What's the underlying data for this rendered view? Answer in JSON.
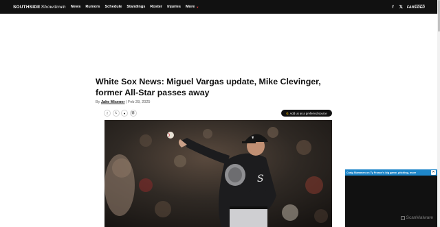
{
  "nav": {
    "logo_main": "SOUTHSIDE",
    "logo_script": "Showdown",
    "links": [
      "News",
      "Rumors",
      "Schedule",
      "Standings",
      "Roster",
      "Injuries"
    ],
    "more_label": "More",
    "social": {
      "facebook": "f",
      "x": "𝕏"
    },
    "fansided_small": "powered by",
    "fansided_big": "FANSIDED"
  },
  "article": {
    "headline": "White Sox News: Miguel Vargas update, Mike Clevinger, former All-Star passes away",
    "by_prefix": "By ",
    "author": "Jake Misener",
    "separator": " | ",
    "date": "Feb 28, 2025",
    "share_icons": [
      "facebook-icon",
      "x-icon",
      "reddit-icon",
      "link-icon"
    ],
    "preferred_source_label": "Add us as a preferred source",
    "preferred_source_icon": "G"
  },
  "video": {
    "title": "Craig Stammen on Ty France's big game, pitching, more",
    "close_label": "✕",
    "watermark": "ScanMalware"
  },
  "colors": {
    "nav_bg": "#111111",
    "accent_red": "#e03a3a",
    "video_bar": "#1e86c9"
  }
}
